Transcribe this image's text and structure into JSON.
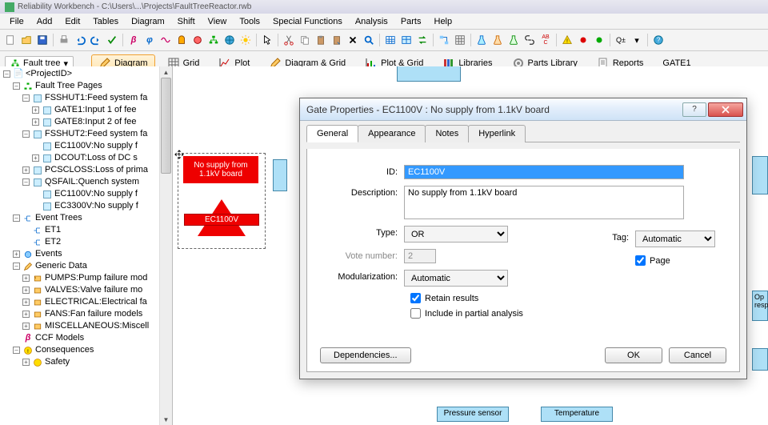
{
  "titlebar": "Reliability Workbench - C:\\Users\\...\\Projects\\FaultTreeReactor.rwb",
  "menu": [
    "File",
    "Add",
    "Edit",
    "Tables",
    "Diagram",
    "Shift",
    "View",
    "Tools",
    "Special Functions",
    "Analysis",
    "Parts",
    "Help"
  ],
  "toolbar2": {
    "faulttree": "Fault tree",
    "diagram": "Diagram",
    "grid": "Grid",
    "plot": "Plot",
    "diagram_grid": "Diagram & Grid",
    "plot_grid": "Plot & Grid",
    "libraries": "Libraries",
    "parts_library": "Parts Library",
    "reports": "Reports",
    "gate1": "GATE1"
  },
  "tree": {
    "root": "<ProjectID>",
    "ftpages": "Fault Tree Pages",
    "fsshut1": "FSSHUT1:Feed system fa",
    "gate1": "GATE1:Input 1 of fee",
    "gate8": "GATE8:Input 2 of fee",
    "fsshut2": "FSSHUT2:Feed system fa",
    "ec1100v_a": "EC1100V:No supply f",
    "dcout": "DCOUT:Loss of DC s",
    "pcscloss": "PCSCLOSS:Loss of prima",
    "qsfail": "QSFAIL:Quench system",
    "ec1100v_b": "EC1100V:No supply f",
    "ec3300v": "EC3300V:No supply f",
    "eventtrees": "Event Trees",
    "et1": "ET1",
    "et2": "ET2",
    "events": "Events",
    "generic": "Generic Data",
    "pumps": "PUMPS:Pump failure mod",
    "valves": "VALVES:Valve failure mo",
    "electrical": "ELECTRICAL:Electrical fa",
    "fans": "FANS:Fan failure models",
    "misc": "MISCELLANEOUS:Miscell",
    "ccf": "CCF Models",
    "consequences": "Consequences",
    "safety": "Safety"
  },
  "canvas": {
    "gate_desc": "No supply from 1.1kV board",
    "gate_id": "EC1100V",
    "op": "Op\nresp",
    "pressure": "Pressure sensor",
    "temperature": "Temperature"
  },
  "dialog": {
    "title": "Gate Properties - EC1100V : No supply from 1.1kV board",
    "tabs": {
      "general": "General",
      "appearance": "Appearance",
      "notes": "Notes",
      "hyperlink": "Hyperlink"
    },
    "labels": {
      "id": "ID:",
      "desc": "Description:",
      "type": "Type:",
      "vote": "Vote number:",
      "mod": "Modularization:",
      "tag": "Tag:",
      "page": "Page",
      "retain": "Retain results",
      "partial": "Include in partial analysis",
      "deps": "Dependencies...",
      "ok": "OK",
      "cancel": "Cancel"
    },
    "values": {
      "id": "EC1100V",
      "desc": "No supply from 1.1kV board",
      "type": "OR",
      "vote": "2",
      "mod": "Automatic",
      "tag": "Automatic"
    }
  }
}
